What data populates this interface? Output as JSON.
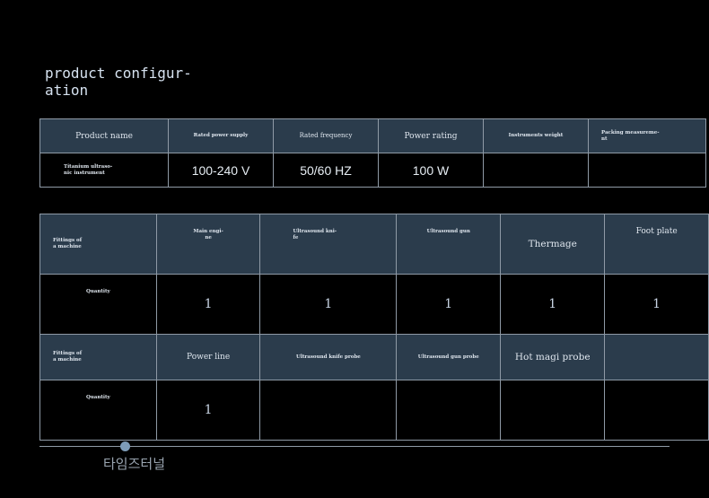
{
  "title": "product configur-\nation",
  "spec_table": {
    "headers": [
      "Product name",
      "Rated power supply",
      "Rated frequency",
      "Power rating",
      "Instruments weight",
      "Packing measureme-\nnt"
    ],
    "row": [
      "Titanium ultraso-\nnic instrument",
      "100-240 V",
      "50/60 HZ",
      "100 W",
      "",
      ""
    ]
  },
  "fittings_table": {
    "row1": [
      "Fittings of\na machine",
      "Main engi-\nne",
      "Ultrasound kni-\nfe",
      "Ultrasound gun",
      "Thermage",
      "Foot plate"
    ],
    "row2": [
      "Quantity",
      "1",
      "1",
      "1",
      "1",
      "1"
    ],
    "row3": [
      "Fittings of\na machine",
      "Power line",
      "Ultrasound knife probe",
      "Ultrasound gun probe",
      "Hot magi probe",
      ""
    ],
    "row4": [
      "Quantity",
      "1",
      "",
      "",
      "",
      ""
    ]
  },
  "footer": {
    "text": "타임즈터널"
  },
  "colors": {
    "header_bg": "#2b3c4c",
    "border": "#8f9aa6",
    "accent_dot": "#7e9cb8"
  }
}
